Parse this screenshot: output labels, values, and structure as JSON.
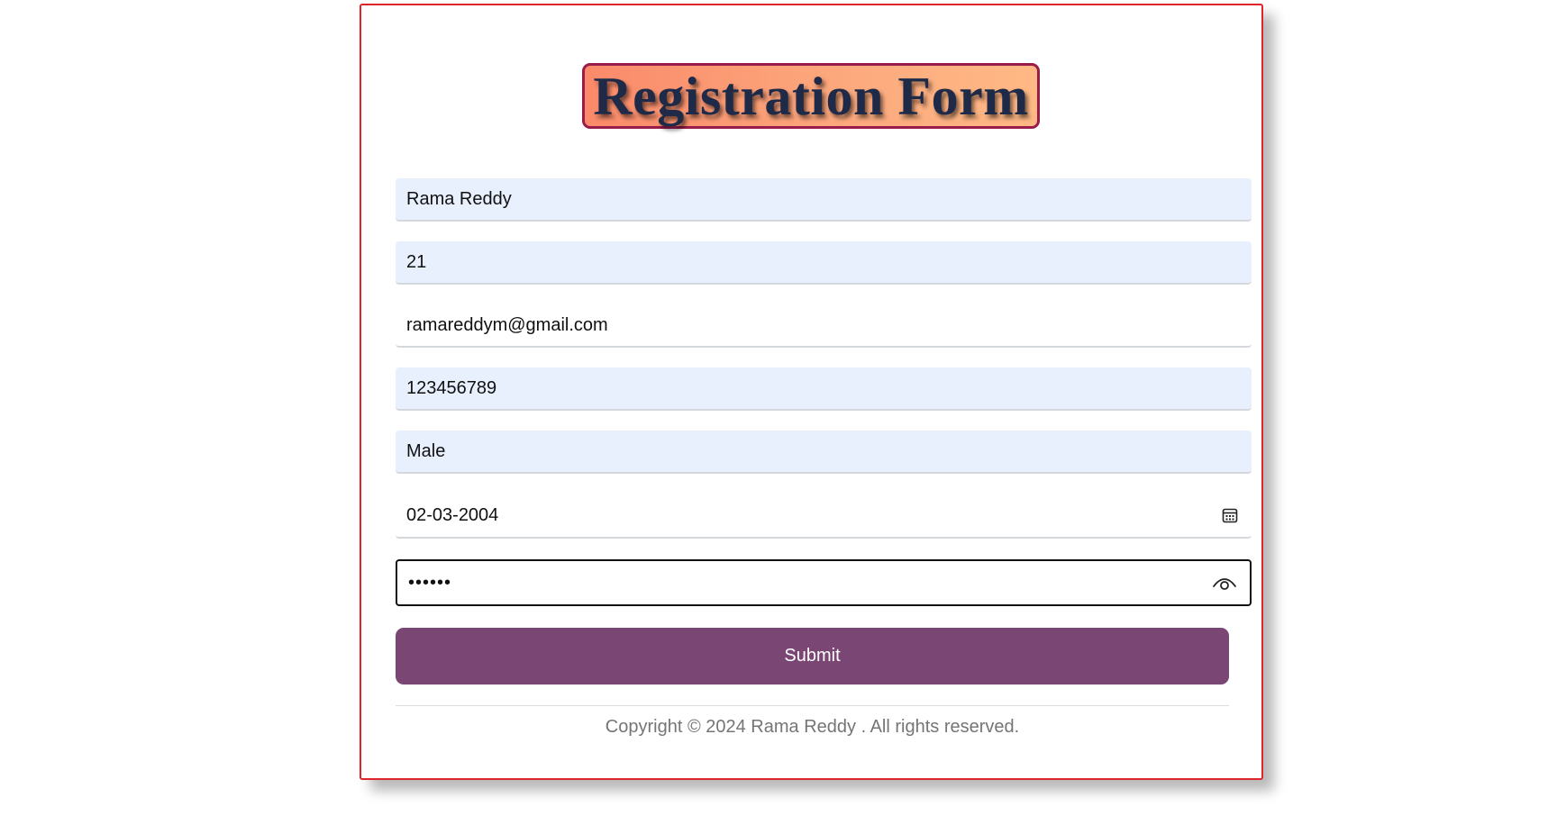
{
  "form": {
    "title": "Registration Form",
    "fields": {
      "name": "Rama Reddy",
      "age": "21",
      "email": "ramareddym@gmail.com",
      "phone": "123456789",
      "gender": "Male",
      "dob": "02-03-2004",
      "password": "••••••"
    },
    "icons": {
      "dob": "calendar-icon",
      "password": "eye-icon"
    },
    "submit_label": "Submit",
    "footer": "Copyright © 2024 Rama Reddy . All rights reserved."
  },
  "colors": {
    "card_border": "#e0242c",
    "title_border": "#9a1c4a",
    "title_gradient_start": "#fa8a6a",
    "title_gradient_end": "#ffb985",
    "title_text": "#1f2a48",
    "autofill_bg": "#e8f0fe",
    "submit_bg": "#7a4775",
    "footer_text": "#757575"
  }
}
